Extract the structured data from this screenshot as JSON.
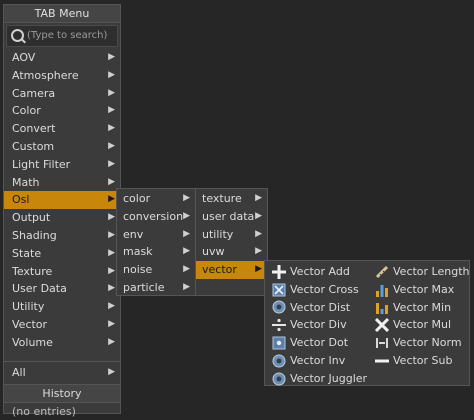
{
  "tab_menu": {
    "title": "TAB Menu",
    "search_placeholder": "(Type to search)",
    "items": [
      {
        "label": "AOV"
      },
      {
        "label": "Atmosphere"
      },
      {
        "label": "Camera"
      },
      {
        "label": "Color"
      },
      {
        "label": "Convert"
      },
      {
        "label": "Custom"
      },
      {
        "label": "Light Filter"
      },
      {
        "label": "Math"
      },
      {
        "label": "Osl"
      },
      {
        "label": "Output"
      },
      {
        "label": "Shading"
      },
      {
        "label": "State"
      },
      {
        "label": "Texture"
      },
      {
        "label": "User Data"
      },
      {
        "label": "Utility"
      },
      {
        "label": "Vector"
      },
      {
        "label": "Volume"
      }
    ],
    "all_label": "All",
    "history_label": "History",
    "history_empty": "(no entries)"
  },
  "osl_submenu": {
    "col1": [
      {
        "label": "color"
      },
      {
        "label": "conversion"
      },
      {
        "label": "env"
      },
      {
        "label": "mask"
      },
      {
        "label": "noise"
      },
      {
        "label": "particle"
      }
    ],
    "col2": [
      {
        "label": "texture"
      },
      {
        "label": "user data"
      },
      {
        "label": "utility"
      },
      {
        "label": "uvw"
      },
      {
        "label": "vector"
      }
    ]
  },
  "vector_submenu": {
    "col1": [
      {
        "label": "Vector Add",
        "icon": "plus-icon"
      },
      {
        "label": "Vector Cross",
        "icon": "cross-product-icon"
      },
      {
        "label": "Vector Dist",
        "icon": "gear-node-icon"
      },
      {
        "label": "Vector Div",
        "icon": "divide-icon"
      },
      {
        "label": "Vector Dot",
        "icon": "dot-product-icon"
      },
      {
        "label": "Vector Inv",
        "icon": "gear-node-icon"
      },
      {
        "label": "Vector Juggler",
        "icon": "gear-node-icon"
      }
    ],
    "col2": [
      {
        "label": "Vector Length",
        "icon": "ruler-icon"
      },
      {
        "label": "Vector Max",
        "icon": "bar-max-icon"
      },
      {
        "label": "Vector Min",
        "icon": "bar-min-icon"
      },
      {
        "label": "Vector Mul",
        "icon": "multiply-icon"
      },
      {
        "label": "Vector Norm",
        "icon": "normalize-icon"
      },
      {
        "label": "Vector Sub",
        "icon": "minus-icon"
      }
    ]
  },
  "colors": {
    "highlight": "#c8860a",
    "panel": "#3b3b3b",
    "text": "#dcdcdc"
  },
  "arrow_glyph": "▶"
}
